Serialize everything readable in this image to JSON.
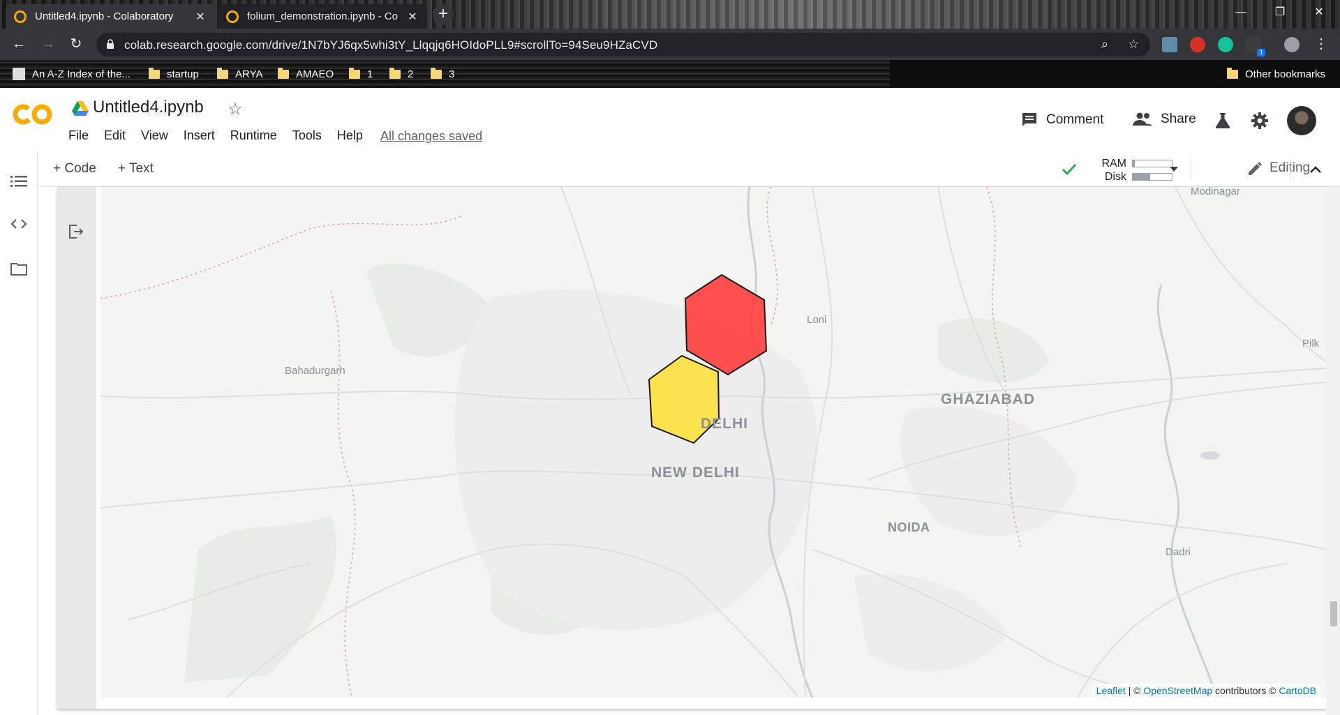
{
  "browser": {
    "tabs": [
      {
        "title": "Untitled4.ipynb - Colaboratory",
        "active": true
      },
      {
        "title": "folium_demonstration.ipynb - Co",
        "active": false
      }
    ],
    "new_tab": "+",
    "close_glyph": "✕",
    "window_controls": {
      "minimize": "—",
      "restore": "❐",
      "close": "✕"
    },
    "url": "colab.research.google.com/drive/1N7bYJ6qx5whi3tY_Llqqjq6HOIdoPLL9#scrollTo=94Seu9HZaCVD",
    "nav": {
      "back": "←",
      "forward": "→",
      "reload": "↻"
    },
    "omni_icons": {
      "zoom": "⌕",
      "star": "☆"
    },
    "extension_badge": "1",
    "bookmarks": [
      {
        "label": "An A-Z Index of the...",
        "icon": "page-icon"
      },
      {
        "label": "startup",
        "icon": "folder-icon"
      },
      {
        "label": "ARYA",
        "icon": "folder-icon"
      },
      {
        "label": "AMAEO",
        "icon": "folder-icon"
      },
      {
        "label": "1",
        "icon": "folder-icon"
      },
      {
        "label": "2",
        "icon": "folder-icon"
      },
      {
        "label": "3",
        "icon": "folder-icon"
      }
    ],
    "other_bookmarks": "Other bookmarks"
  },
  "colab": {
    "notebook_title": "Untitled4.ipynb",
    "star_glyph": "☆",
    "menu": [
      "File",
      "Edit",
      "View",
      "Insert",
      "Runtime",
      "Tools",
      "Help"
    ],
    "save_status": "All changes saved",
    "header_actions": {
      "comment": "Comment",
      "share": "Share"
    },
    "toolbar": {
      "add_code": "+ Code",
      "add_text": "+ Text",
      "ram_label": "RAM",
      "disk_label": "Disk",
      "ram_usage": 0.05,
      "disk_usage": 0.45,
      "mode": "Editing",
      "collapse_glyph": "⌃"
    }
  },
  "map": {
    "labels": [
      {
        "text": "Modinagar",
        "cls": "small"
      },
      {
        "text": "Loni",
        "cls": "small"
      },
      {
        "text": "Pilk",
        "cls": "small"
      },
      {
        "text": "Bahadurgarh",
        "cls": "small"
      },
      {
        "text": "GHAZIABAD",
        "cls": "big"
      },
      {
        "text": "DELHI",
        "cls": "big"
      },
      {
        "text": "NEW DELHI",
        "cls": "big"
      },
      {
        "text": "NOIDA",
        "cls": "mid"
      },
      {
        "text": "Dadri",
        "cls": "small"
      }
    ],
    "hexagons": [
      {
        "color": "#ff3333",
        "name": "red-hexagon"
      },
      {
        "color": "#ffe033",
        "name": "yellow-hexagon"
      }
    ],
    "attribution": {
      "leaflet": "Leaflet",
      "sep1": " | © ",
      "osm": "OpenStreetMap",
      "contributors": " contributors © ",
      "carto": "CartoDB"
    }
  }
}
